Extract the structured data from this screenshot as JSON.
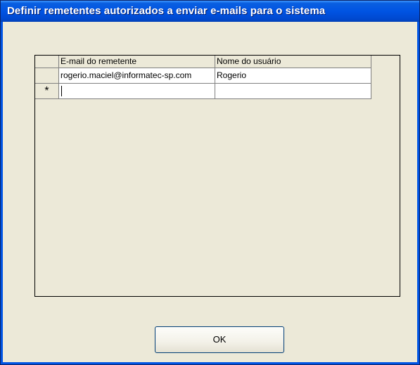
{
  "window": {
    "title": "Definir remetentes autorizados a enviar e-mails para o sistema"
  },
  "grid": {
    "columns": [
      "E-mail do remetente",
      "Nome do usuário"
    ],
    "rows": [
      [
        "rogerio.maciel@informatec-sp.com",
        "Rogerio"
      ]
    ],
    "new_row_marker": "*",
    "new_row_values": [
      "",
      ""
    ]
  },
  "buttons": {
    "ok_label": "OK"
  },
  "colors": {
    "titlebar": "#0054e3",
    "window_background": "#ece9d8",
    "cell_background": "#ffffff"
  }
}
